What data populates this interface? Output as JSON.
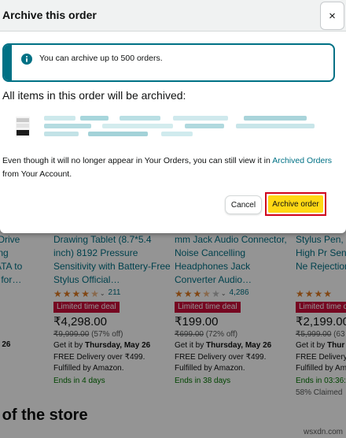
{
  "modal": {
    "title": "Archive this order",
    "close_label": "×",
    "info_text": "You can archive up to 500 orders.",
    "heading": "All items in this order will be archived:",
    "description_before": "Even though it will no longer appear in Your Orders, you can still view it in ",
    "description_link": "Archived Orders",
    "description_after": " from Your Account.",
    "cancel_label": "Cancel",
    "archive_label": "Archive order",
    "accent_color": "#007185",
    "archive_button_color": "#ffd814"
  },
  "background": {
    "products": [
      {
        "title": " Drive\n ng\nATA to\nr for…",
        "rating_count": "",
        "deal": "",
        "price": "",
        "mrp": "",
        "delivery_date": "y 26",
        "free_delivery": "",
        "fulfilled": "",
        "ends": "",
        "claimed": ""
      },
      {
        "title": "Drawing Tablet (8.7*5.4 inch) 8192 Pressure Sensitivity with Battery-Free Stylus Official…",
        "rating": 4.5,
        "rating_count": "211",
        "deal": "Limited time deal",
        "price": "₹4,298.00",
        "mrp": "₹9,999.00",
        "discount": " (57% off)",
        "delivery_prefix": "Get it by ",
        "delivery_date": "Thursday, May 26",
        "free_delivery": "FREE Delivery over ₹499.",
        "fulfilled": "Fulfilled by Amazon.",
        "ends": "Ends in 4 days",
        "claimed": ""
      },
      {
        "title": "mm Jack Audio Connector, Noise Cancelling Headphones Jack Converter Audio…",
        "rating": 3.5,
        "rating_count": "4,286",
        "deal": "Limited time deal",
        "price": "₹199.00",
        "mrp": "₹699.00",
        "discount": " (72% off)",
        "delivery_prefix": "Get it by ",
        "delivery_date": "Thursday, May 26",
        "free_delivery": "FREE Delivery over ₹499.",
        "fulfilled": "Fulfilled by Amazon.",
        "ends": "Ends in 38 days",
        "claimed": ""
      },
      {
        "title": "Stylus Pen, iF Ultra High Pr Sensitivity, Ne Rejection, Pr",
        "rating": 4.5,
        "rating_count": "",
        "deal": "Limited time d",
        "price": "₹2,199.00",
        "mrp": "₹5,999.00",
        "discount": " (63",
        "delivery_prefix": "Get it by ",
        "delivery_date": "Thur",
        "free_delivery": "FREE Delivery",
        "fulfilled": "Fulfilled by Ama",
        "ends": "Ends in 03:36:0",
        "claimed": "58% Claimed"
      }
    ],
    "store_heading": "s of the store",
    "watermark": "wsxdn.com"
  }
}
